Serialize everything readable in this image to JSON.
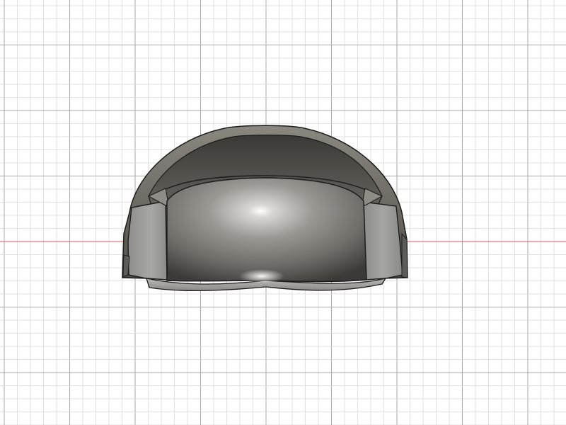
{
  "viewport": {
    "background_color": "#ffffff",
    "grid": true,
    "minor_grid_color": "#d9d9d9",
    "major_grid_color": "#a9a9a9",
    "axis_color": "#e77a7a"
  },
  "model": {
    "visible": true,
    "body_color": "#8c8c8a",
    "edge_color": "#1c1c1c"
  }
}
